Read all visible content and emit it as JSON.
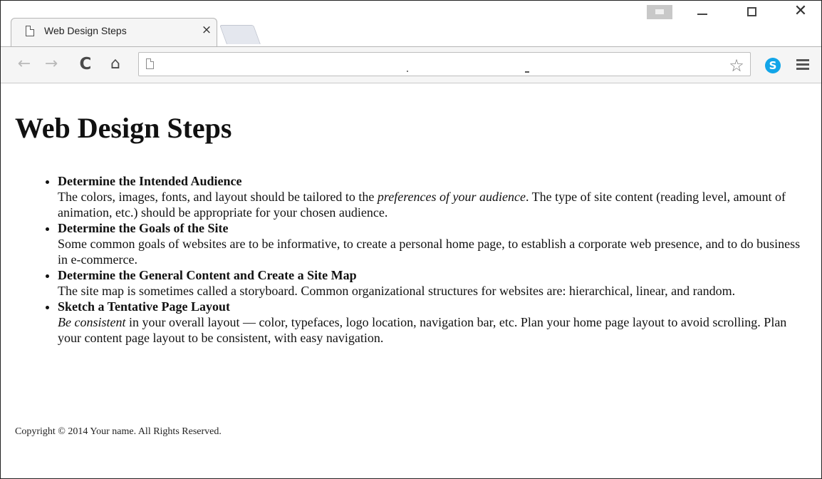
{
  "browser": {
    "tab_title": "Web Design Steps",
    "tab_close_glyph": "×",
    "window_close_glyph": "✕",
    "back_glyph": "←",
    "forward_glyph": "→",
    "reload_glyph": "C",
    "home_glyph": "⌂",
    "star_glyph": "☆",
    "skype_letter": "S",
    "skype_color": "#12a5e8",
    "address_value": ""
  },
  "page": {
    "title": "Web Design Steps",
    "steps": [
      {
        "heading": "Determine the Intended Audience",
        "text_before": "The colors, images, fonts, and layout should be tailored to the ",
        "text_emphasis": "preferences of your audience",
        "text_after": ". The type of site content (reading level, amount of animation, etc.) should be appropriate for your chosen audience."
      },
      {
        "heading": "Determine the Goals of the Site",
        "text": "Some common goals of websites are to be informative, to create a personal home page, to establish a corporate web presence, and to do business in e-commerce."
      },
      {
        "heading": "Determine the General Content and Create a Site Map",
        "text": "The site map is sometimes called a storyboard. Common organizational structures for websites are: hierarchical, linear, and random."
      },
      {
        "heading": "Sketch a Tentative Page Layout",
        "text_emphasis": "Be consistent",
        "text_after": " in your overall layout — color, typefaces, logo location, navigation bar, etc. Plan your home page layout to avoid scrolling. Plan your content page layout to be consistent, with easy navigation."
      }
    ],
    "copyright": "Copyright © 2014 Your name. All Rights Reserved."
  }
}
